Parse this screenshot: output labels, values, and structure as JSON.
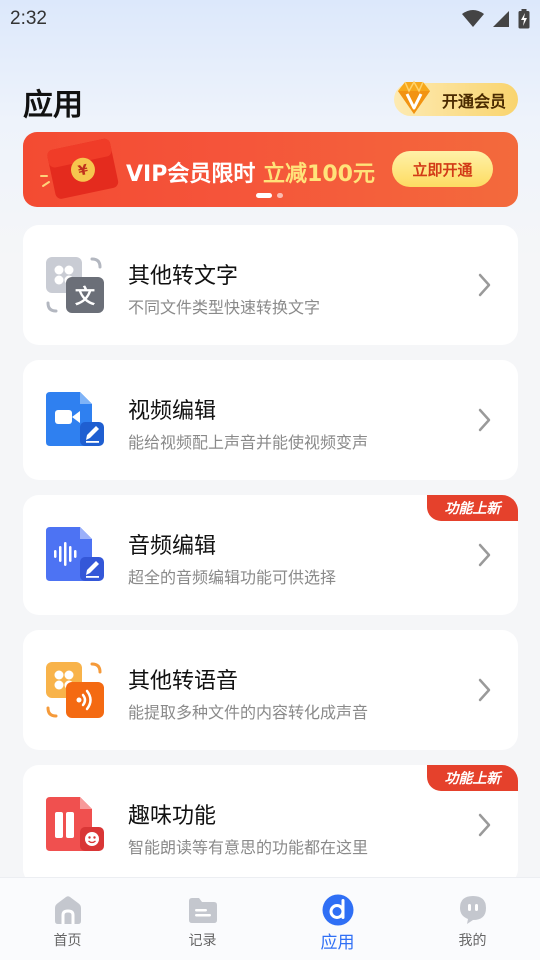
{
  "status_bar": {
    "time": "2:32"
  },
  "header": {
    "title": "应用",
    "vip_button": "开通会员"
  },
  "banner": {
    "text_prefix": "VIP会员限时",
    "text_highlight": "立减100元",
    "button": "立即开通",
    "envelope_symbol": "¥"
  },
  "cards": [
    {
      "title": "其他转文字",
      "desc": "不同文件类型快速转换文字",
      "icon": "file-to-text-icon",
      "icon_glyph": "文",
      "badge": ""
    },
    {
      "title": "视频编辑",
      "desc": "能给视频配上声音并能使视频变声",
      "icon": "video-edit-icon",
      "badge": ""
    },
    {
      "title": "音频编辑",
      "desc": "超全的音频编辑功能可供选择",
      "icon": "audio-edit-icon",
      "badge": "功能上新"
    },
    {
      "title": "其他转语音",
      "desc": "能提取多种文件的内容转化成声音",
      "icon": "file-to-speech-icon",
      "badge": ""
    },
    {
      "title": "趣味功能",
      "desc": "智能朗读等有意思的功能都在这里",
      "icon": "fun-features-icon",
      "badge": "功能上新"
    }
  ],
  "bottom_nav": [
    {
      "label": "首页",
      "icon": "home-icon",
      "active": false
    },
    {
      "label": "记录",
      "icon": "folder-icon",
      "active": false
    },
    {
      "label": "应用",
      "icon": "apps-icon",
      "active": true
    },
    {
      "label": "我的",
      "icon": "profile-icon",
      "active": false
    }
  ],
  "colors": {
    "accent_blue": "#2f6ff5",
    "banner_red": "#f34b32",
    "badge_red": "#e5412c",
    "vip_gold": "#f9d46e"
  }
}
